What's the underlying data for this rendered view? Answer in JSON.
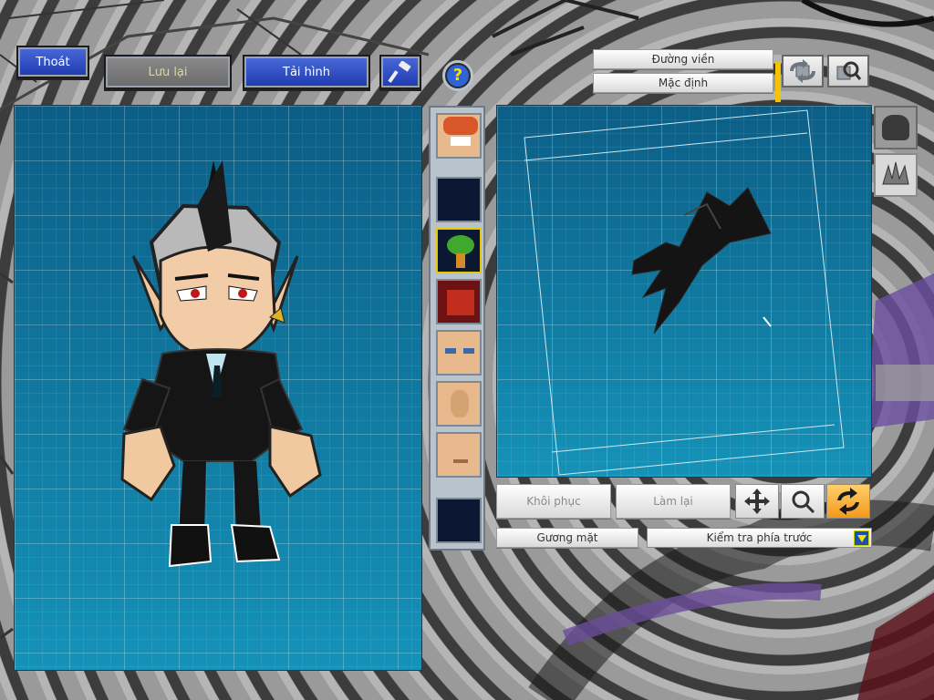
{
  "top_buttons": {
    "exit_label": "Thoát",
    "save_label": "Lưu lại",
    "reload_label": "Tải hình"
  },
  "right_top": {
    "outline_label": "Đường viền",
    "default_label": "Mặc định"
  },
  "bottom_controls": {
    "restore_label": "Khôi phục",
    "redo_label": "Làm lại",
    "face_label": "Gương mặt",
    "view_select_value": "Kiểm tra phía trước"
  },
  "icons": {
    "hammer": "hammer-icon",
    "help": "question-mark-icon",
    "rotate": "rotate-icon",
    "zoom": "magnifier-icon",
    "move": "move-arrows-icon",
    "refresh": "refresh-icon"
  },
  "colors": {
    "grid_blue": "#0f7aa0",
    "button_blue": "#1f3ab0",
    "active_tool": "#f29a1c"
  }
}
